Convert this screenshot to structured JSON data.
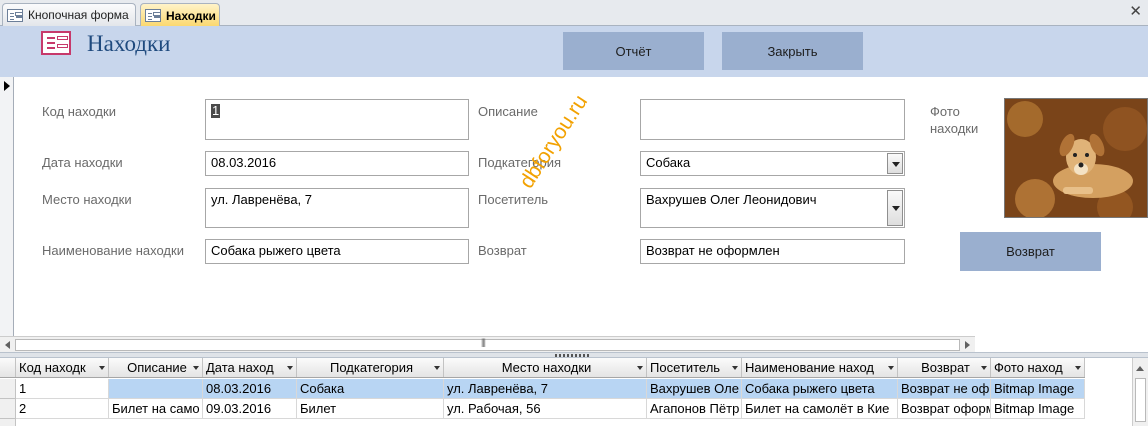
{
  "tabs": [
    {
      "label": "Кнопочная форма",
      "active": false
    },
    {
      "label": "Находки",
      "active": true
    }
  ],
  "header": {
    "title": "Находки",
    "report_button": "Отчёт",
    "close_button": "Закрыть"
  },
  "form": {
    "fields": {
      "code": {
        "label": "Код находки",
        "value": "1"
      },
      "date": {
        "label": "Дата находки",
        "value": "08.03.2016"
      },
      "place": {
        "label": "Место находки",
        "value": "ул. Лавренёва, 7"
      },
      "name": {
        "label": "Наименование находки",
        "value": "Собака рыжего цвета"
      },
      "description": {
        "label": "Описание",
        "value": ""
      },
      "subcategory": {
        "label": "Подкатегория",
        "value": "Собака"
      },
      "visitor": {
        "label": "Посетитель",
        "value": "Вахрушев Олег Леонидович"
      },
      "return": {
        "label": "Возврат",
        "value": "Возврат не оформлен"
      }
    },
    "photo_label": "Фото находки",
    "photo_icon": "dog-photo",
    "return_button": "Возврат",
    "watermark": "dbforyou.ru"
  },
  "datasheet": {
    "columns": [
      "Код находк",
      "Описание",
      "Дата наход",
      "Подкатегория",
      "Место находки",
      "Посетитель",
      "Наименование наход",
      "Возврат",
      "Фото наход"
    ],
    "rows": [
      [
        "1",
        "",
        "08.03.2016",
        "Собака",
        "ул. Лавренёва, 7",
        "Вахрушев Оле",
        "Собака рыжего цвета",
        "Возврат не оф",
        "Bitmap Image"
      ],
      [
        "2",
        "Билет на само",
        "09.03.2016",
        "Билет",
        "ул. Рабочая, 56",
        "Агапонов Пётр",
        "Билет на самолёт в Кие",
        "Возврат оформ",
        "Bitmap Image"
      ]
    ]
  },
  "colors": {
    "header_bg": "#c8d6ec",
    "button_bg": "#9aafcf",
    "title_color": "#1f4a7e",
    "selected_row": "#b8d5f3",
    "active_tab": "#fbd76c",
    "watermark": "#f2a100"
  }
}
